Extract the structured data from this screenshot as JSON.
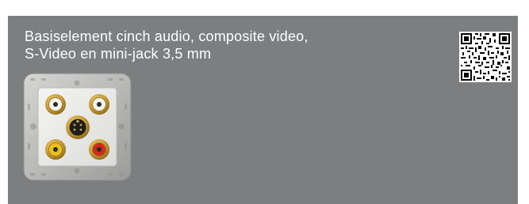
{
  "product_card": {
    "title_line_1": "Basiselement cinch audio, composite video,",
    "title_line_2": "S-Video en mini-jack 3,5 mm",
    "background_color": "#7d7e80",
    "text_color": "#ffffff"
  },
  "product_image": {
    "icon": "wall-socket-av-panel-image",
    "connectors": [
      "cinch-white",
      "cinch-white",
      "s-video",
      "cinch-yellow",
      "cinch-red"
    ]
  },
  "qr_code": {
    "icon": "qr-code-icon"
  }
}
